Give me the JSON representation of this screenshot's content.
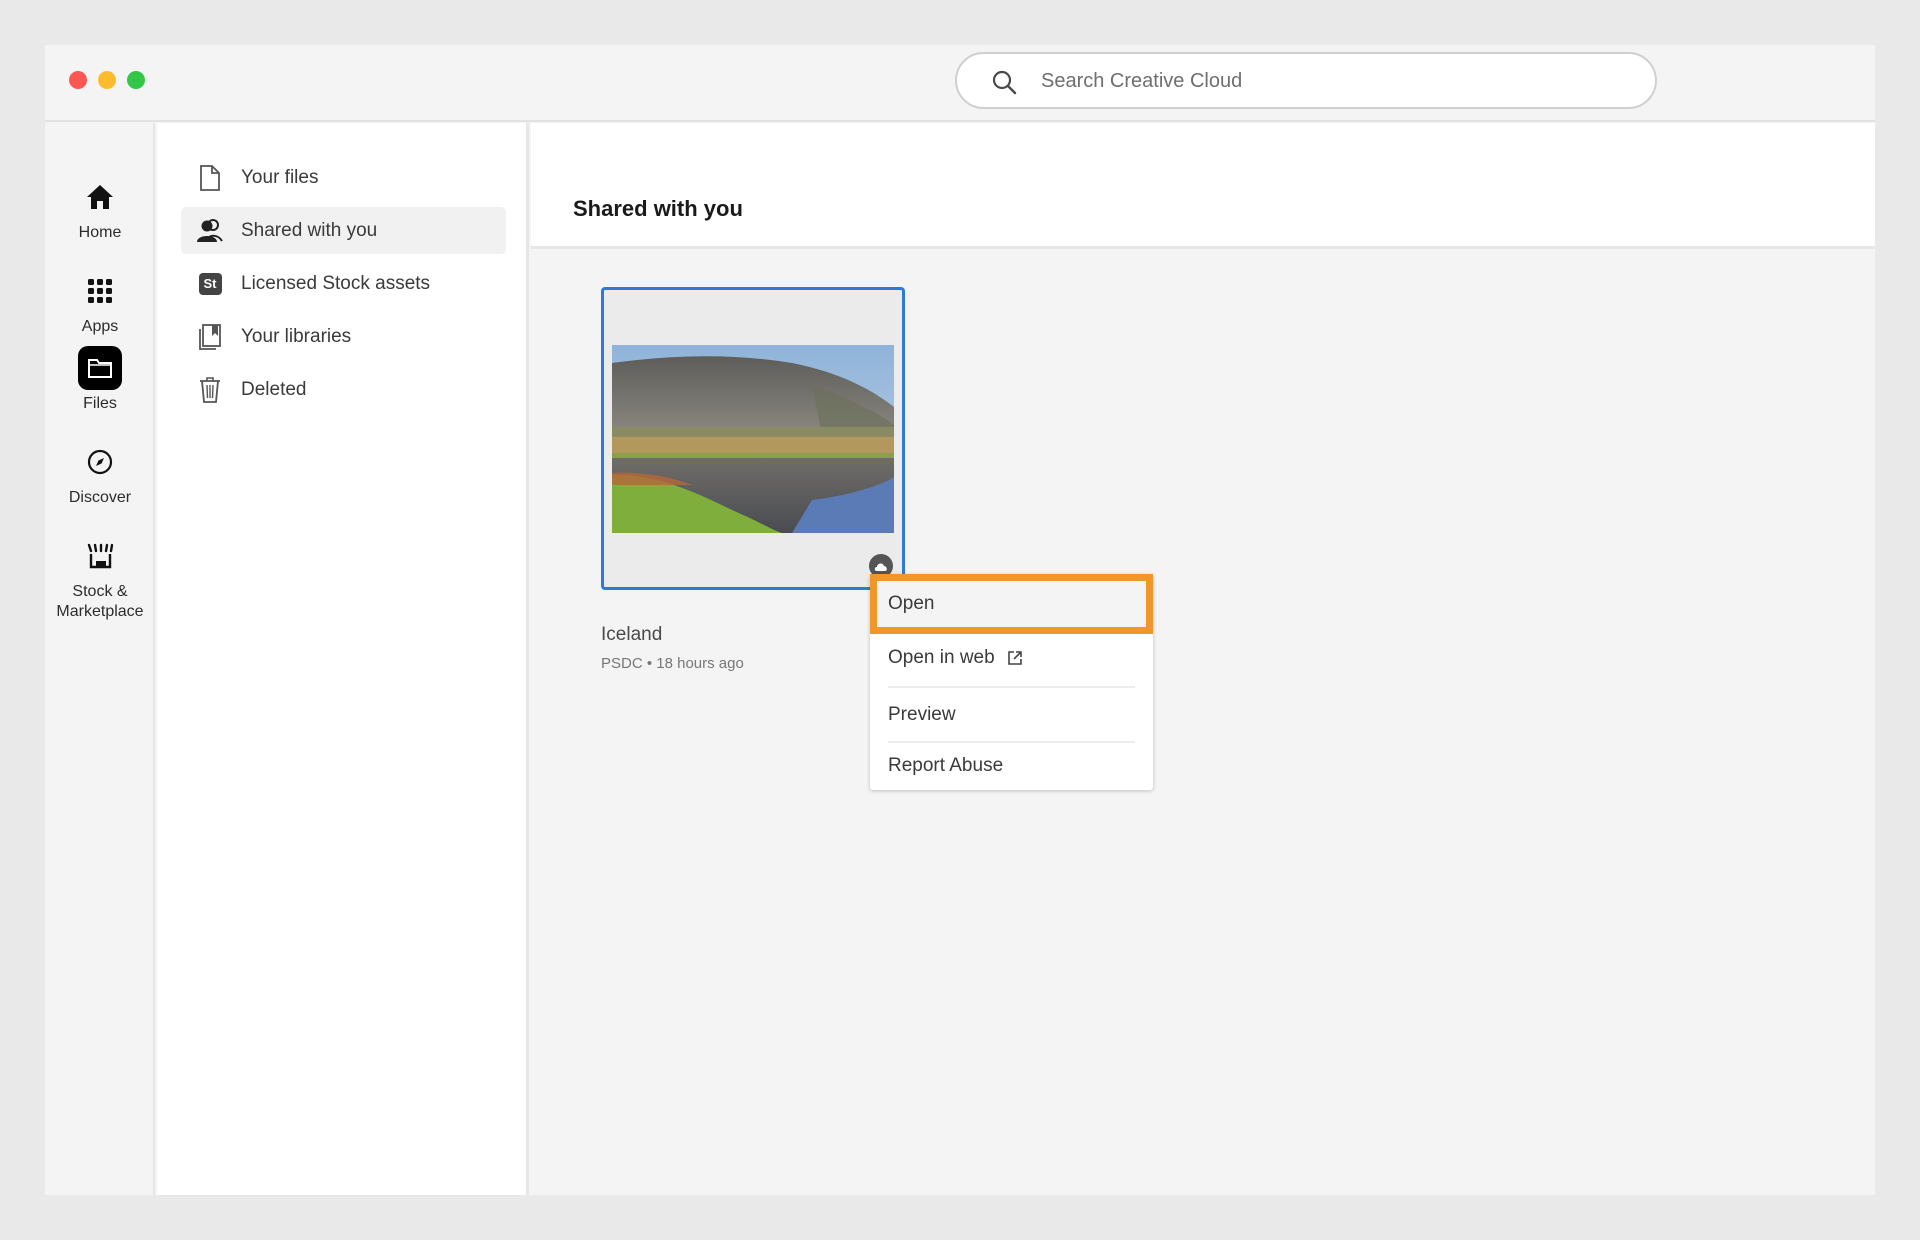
{
  "window": {
    "controls": [
      "close",
      "minimize",
      "maximize"
    ]
  },
  "search": {
    "placeholder": "Search Creative Cloud",
    "value": "",
    "icon": "search-icon"
  },
  "rail": {
    "items": [
      {
        "label": "Home",
        "icon": "home-icon",
        "active": false
      },
      {
        "label": "Apps",
        "icon": "apps-grid-icon",
        "active": false
      },
      {
        "label": "Files",
        "icon": "folder-icon",
        "active": true
      },
      {
        "label": "Discover",
        "icon": "compass-icon",
        "active": false
      },
      {
        "label": "Stock &\nMarketplace",
        "label_line1": "Stock &",
        "label_line2": "Marketplace",
        "icon": "storefront-icon",
        "active": false
      }
    ]
  },
  "sidebar": {
    "items": [
      {
        "label": "Your files",
        "icon": "file-icon",
        "active": false
      },
      {
        "label": "Shared with you",
        "icon": "people-icon",
        "active": true
      },
      {
        "label": "Licensed Stock assets",
        "icon": "stock-st-icon",
        "icon_text": "St",
        "active": false
      },
      {
        "label": "Your libraries",
        "icon": "libraries-icon",
        "active": false
      },
      {
        "label": "Deleted",
        "icon": "trash-icon",
        "active": false
      }
    ]
  },
  "main": {
    "title": "Shared with you",
    "files": [
      {
        "name": "Iceland",
        "type": "PSDC",
        "modified": "18 hours ago",
        "meta": "PSDC • 18 hours ago",
        "thumbnail": "mountain reflected in lake",
        "badge_icon": "cloud-icon",
        "selected": true
      }
    ]
  },
  "context_menu": {
    "items": [
      {
        "label": "Open",
        "highlighted": true
      },
      {
        "label": "Open in web",
        "icon": "external-link-icon"
      },
      {
        "label": "Preview"
      },
      {
        "label": "Report Abuse"
      }
    ],
    "highlight_color": "#F0962A"
  },
  "colors": {
    "selection_border": "#2F7AD8",
    "highlight": "#F0962A",
    "close": "#FC5753",
    "minimize": "#FDBC2E",
    "maximize": "#33C748"
  }
}
